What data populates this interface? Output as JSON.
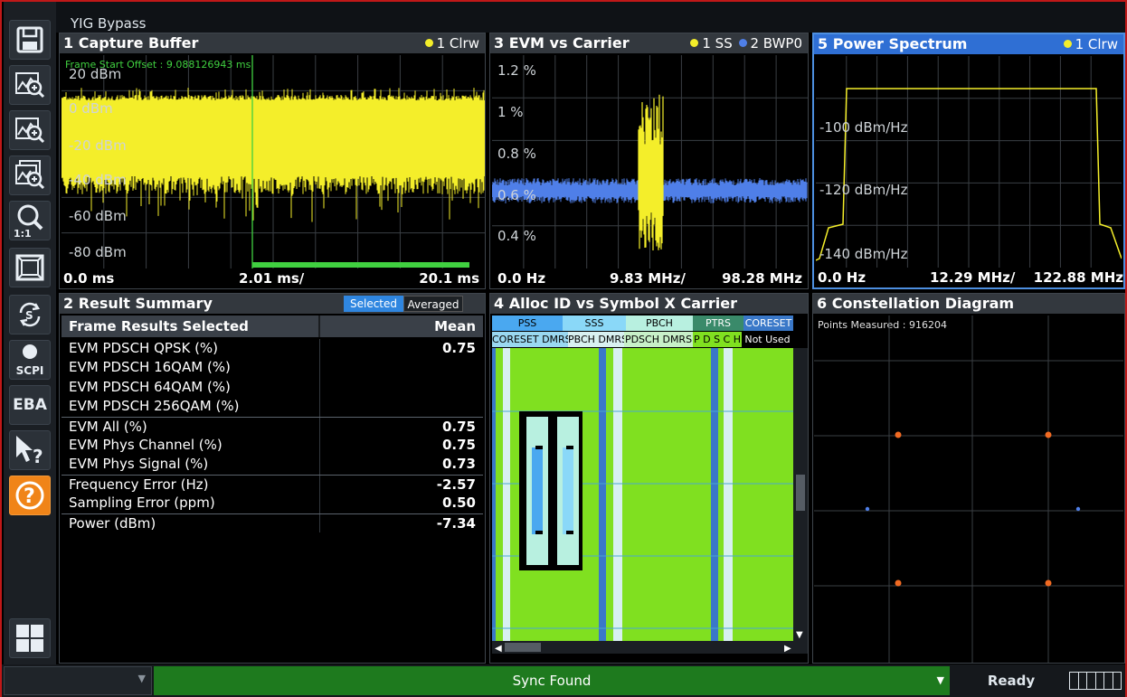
{
  "app": {
    "status_line": "YIG Bypass"
  },
  "toolbar": {
    "items": [
      {
        "name": "save-icon"
      },
      {
        "name": "zoom-trace-icon"
      },
      {
        "name": "zoom-icon"
      },
      {
        "name": "multi-zoom-icon"
      },
      {
        "name": "zoom-1-1-icon",
        "label": "1:1"
      },
      {
        "name": "full-screen-icon"
      },
      {
        "name": "sequencer-icon"
      },
      {
        "name": "scpi-icon",
        "label": "SCPI"
      },
      {
        "name": "eba-icon",
        "label": "EBA"
      },
      {
        "name": "help-pointer-icon"
      },
      {
        "name": "help-icon",
        "label": "?"
      },
      {
        "name": "windows-icon"
      }
    ]
  },
  "windows": {
    "capture": {
      "title": "1 Capture Buffer",
      "trace": "1 Clrw",
      "annotation": "Frame Start Offset : 9.088126943 ms",
      "y_labels": [
        "20 dBm",
        "0 dBm",
        "-20 dBm",
        "-40 dBm",
        "-60 dBm",
        "-80 dBm"
      ],
      "x_start": "0.0  ms",
      "x_div": "2.01 ms/",
      "x_end": "20.1 ms"
    },
    "evm": {
      "title": "3 EVM vs Carrier",
      "trace1": "1 SS",
      "trace2": "2 BWP0",
      "y_labels": [
        "1.2 %",
        "1 %",
        "0.8 %",
        "0.6 %",
        "0.4 %"
      ],
      "x_start": "0.0 Hz",
      "x_div": "9.83 MHz/",
      "x_end": "98.28 MHz"
    },
    "spectrum": {
      "title": "5 Power Spectrum",
      "trace": "1 Clrw",
      "y_labels": [
        "-100 dBm/Hz",
        "-120 dBm/Hz",
        "-140 dBm/Hz"
      ],
      "x_start": "0.0 Hz",
      "x_div": "12.29 MHz/",
      "x_end": "122.88 MHz"
    },
    "summary": {
      "title": "2 Result Summary",
      "mode_selected": "Selected",
      "mode_averaged": "Averaged",
      "col_name": "Frame Results Selected",
      "col_value": "Mean",
      "rows": [
        {
          "label": "EVM PDSCH QPSK (%)",
          "value": "0.75"
        },
        {
          "label": "EVM PDSCH 16QAM (%)",
          "value": ""
        },
        {
          "label": "EVM PDSCH 64QAM (%)",
          "value": ""
        },
        {
          "label": "EVM PDSCH 256QAM (%)",
          "value": ""
        },
        {
          "label": "EVM All (%)",
          "value": "0.75"
        },
        {
          "label": "EVM Phys Channel (%)",
          "value": "0.75"
        },
        {
          "label": "EVM Phys Signal (%)",
          "value": "0.73"
        },
        {
          "label": "Frequency Error (Hz)",
          "value": "-2.57"
        },
        {
          "label": "Sampling Error (ppm)",
          "value": "0.50"
        },
        {
          "label": "Power (dBm)",
          "value": "-7.34"
        }
      ]
    },
    "alloc": {
      "title": "4 Alloc ID vs Symbol X Carrier",
      "legend_top": [
        {
          "label": "PSS",
          "color": "#4aa8f0"
        },
        {
          "label": "SSS",
          "color": "#8ad8f8"
        },
        {
          "label": "PBCH",
          "color": "#b8f0e0"
        },
        {
          "label": "PTRS",
          "color": "#3a8a6a"
        },
        {
          "label": "CORESET",
          "color": "#3a78c8"
        }
      ],
      "legend_bottom": [
        {
          "label": "CORESET DMRS",
          "color": "#9ad8f0"
        },
        {
          "label": "PBCH DMRS",
          "color": "#d8f0f0"
        },
        {
          "label": "PDSCH DMRS",
          "color": "#c8f0c8"
        },
        {
          "label": "P D S C H",
          "color": "#80e020"
        },
        {
          "label": "Not Used",
          "color": "#000000"
        }
      ]
    },
    "constellation": {
      "title": "6 Constellation Diagram",
      "points_label": "Points Measured : 916204"
    }
  },
  "status": {
    "left_dropdown": "",
    "sync": "Sync Found",
    "ready": "Ready"
  },
  "colors": {
    "trace_yellow": "#f4ee2a",
    "trace_blue": "#4f7fe8",
    "grid": "#3a3f44",
    "active_border": "#4d8fe0",
    "alloc_green": "#80e020",
    "sync_green": "#1e7a1e"
  }
}
